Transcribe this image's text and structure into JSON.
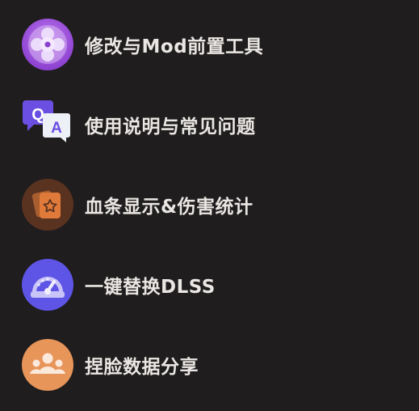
{
  "menu": {
    "items": [
      {
        "label": "修改与Mod前置工具",
        "icon": "mod-tool-icon",
        "color": "#9b4fd6"
      },
      {
        "label": "使用说明与常见问题",
        "icon": "qa-icon",
        "color": "#6a56e0"
      },
      {
        "label": "血条显示&伤害统计",
        "icon": "card-stack-icon",
        "color": "#5a3220"
      },
      {
        "label": "一键替换DLSS",
        "icon": "speedometer-icon",
        "color": "#5e55e6"
      },
      {
        "label": "捏脸数据分享",
        "icon": "group-users-icon",
        "color": "#e8955a"
      }
    ]
  }
}
